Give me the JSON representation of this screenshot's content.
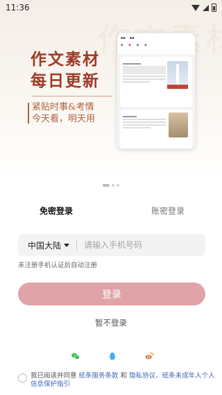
{
  "status": {
    "time": "11:36"
  },
  "banner": {
    "headline_line1": "作文素材",
    "headline_line2": "每日更新",
    "sub_line1": "紧贴时事&考情",
    "sub_line2": "今天看，明天用",
    "watermark": "作文素材"
  },
  "tabs": {
    "active": "免密登录",
    "inactive": "账密登录"
  },
  "phone_field": {
    "region": "中国大陆",
    "placeholder": "请输入手机号码",
    "value": ""
  },
  "hint": "未注册手机认证后自动注册",
  "login_button": "登录",
  "skip_login": "暂不登录",
  "social": [
    "wechat-icon",
    "qq-icon",
    "weibo-icon"
  ],
  "agreement": {
    "prefix": "我已阅读并同意 ",
    "terms": "纸条服务条款",
    "and": " 和 ",
    "privacy": "隐私协议、纸条未成年人个人信息保护指引"
  },
  "colors": {
    "primary_disabled": "#e0a3a8",
    "headline": "#9c3a26",
    "link": "#3a67b5",
    "wechat": "#27c04a",
    "qq": "#3cb4f0",
    "weibo": "#e6542d"
  },
  "carousel": {
    "count": 3,
    "active": 0
  }
}
